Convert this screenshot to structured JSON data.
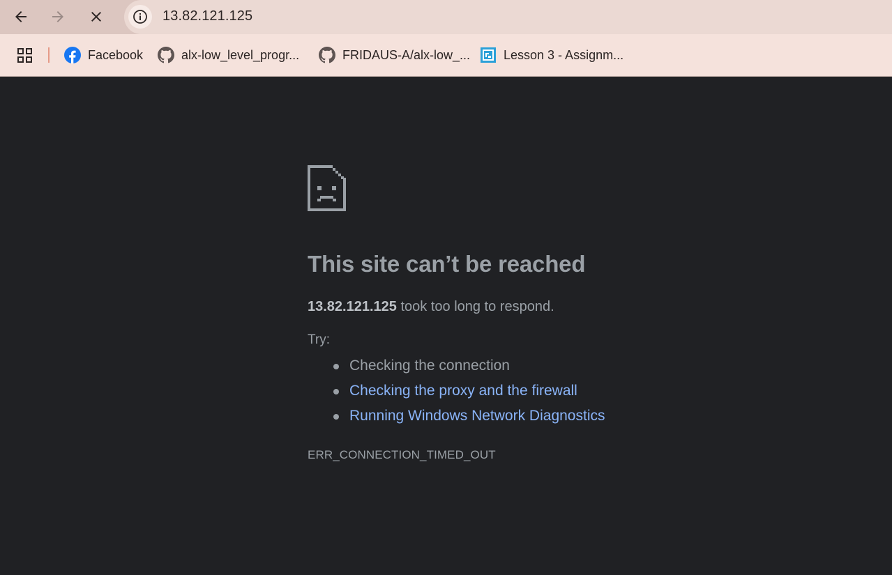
{
  "toolbar": {
    "back_icon": "arrow-left-icon",
    "forward_icon": "arrow-right-icon",
    "stop_icon": "close-icon",
    "info_icon": "info-icon",
    "url": "13.82.121.125"
  },
  "bookmarks": {
    "apps_icon": "apps-grid-icon",
    "items": [
      {
        "label": "Facebook",
        "icon": "facebook-icon"
      },
      {
        "label": "alx-low_level_progr...",
        "icon": "github-icon"
      },
      {
        "label": "FRIDAUS-A/alx-low_...",
        "icon": "github-icon"
      },
      {
        "label": "Lesson 3 - Assignm...",
        "icon": "lesson-icon"
      }
    ]
  },
  "error_page": {
    "icon": "sad-page-icon",
    "title": "This site can’t be reached",
    "host": "13.82.121.125",
    "message": "took too long to respond.",
    "try_label": "Try:",
    "suggestions": [
      {
        "text": "Checking the connection",
        "link": false
      },
      {
        "text": "Checking the proxy and the firewall",
        "link": true
      },
      {
        "text": "Running Windows Network Diagnostics",
        "link": true
      }
    ],
    "error_code": "ERR_CONNECTION_TIMED_OUT"
  },
  "colors": {
    "page_background": "#202124",
    "text": "#9aa0a6",
    "link": "#8ab4f8",
    "toolbar": "#dcc6c0",
    "bookmarks_bar": "#f5e2dc",
    "facebook_blue": "#1877f2"
  }
}
